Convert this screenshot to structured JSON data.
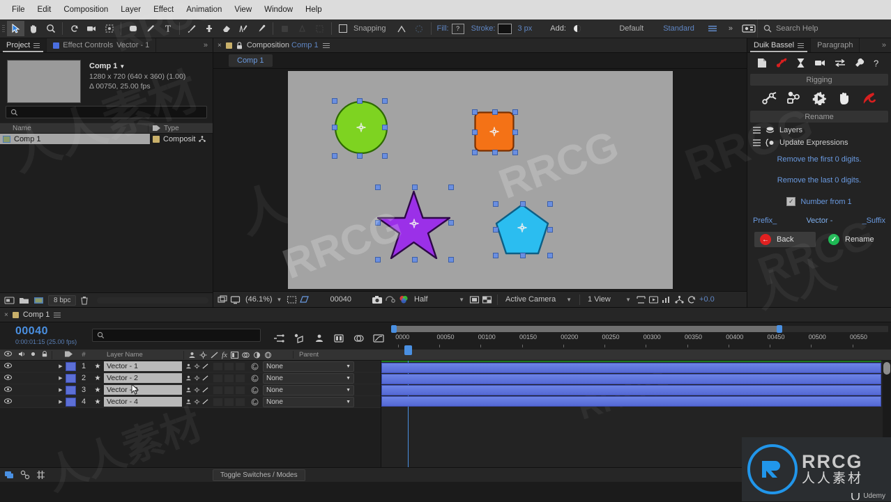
{
  "app": {
    "menus": [
      "File",
      "Edit",
      "Composition",
      "Layer",
      "Effect",
      "Animation",
      "View",
      "Window",
      "Help"
    ]
  },
  "toolbar": {
    "tools": [
      {
        "name": "selection-tool",
        "icon": "arrow",
        "active": true
      },
      {
        "name": "hand-tool",
        "icon": "hand"
      },
      {
        "name": "zoom-tool",
        "icon": "magnifier"
      },
      {
        "name": "rotation-tool",
        "icon": "rotate"
      },
      {
        "name": "camera-tool",
        "icon": "camera"
      },
      {
        "name": "pan-behind-tool",
        "icon": "anchor-point"
      },
      {
        "name": "shape-tool",
        "icon": "rounded-square"
      },
      {
        "name": "pen-tool",
        "icon": "pen"
      },
      {
        "name": "type-tool",
        "icon": "type"
      },
      {
        "name": "brush-tool",
        "icon": "brush"
      },
      {
        "name": "clone-stamp-tool",
        "icon": "stamp"
      },
      {
        "name": "eraser-tool",
        "icon": "eraser"
      },
      {
        "name": "roto-brush-tool",
        "icon": "roto-brush"
      },
      {
        "name": "puppet-pin-tool",
        "icon": "puppet-pin"
      }
    ],
    "snapping_label": "Snapping",
    "fill_label": "Fill:",
    "fill_value": "?",
    "stroke_label": "Stroke:",
    "stroke_width": "3 px",
    "add_label": "Add:",
    "workspace_default": "Default",
    "workspace_standard": "Standard",
    "overflow": "»",
    "search_help_placeholder": "Search Help"
  },
  "project_panel": {
    "tab_project": "Project",
    "tab_effect_controls": "Effect Controls",
    "tab_effect_controls_item": "Vector - 1",
    "comp_name": "Comp 1",
    "comp_resolution": "1280 x 720  (640 x 360) (1.00)",
    "comp_duration": "Δ 00750, 25.00 fps",
    "search_placeholder": "",
    "columns": [
      "Name",
      "Type"
    ],
    "rows": [
      {
        "name": "Comp 1",
        "type": "Composit",
        "selected": true
      }
    ],
    "footer": {
      "bit_depth": "8 bpc"
    }
  },
  "composition_panel": {
    "tab_label": "Composition",
    "tab_comp_name": "Comp 1",
    "sub_tab": "Comp 1",
    "footer": {
      "zoom": "(46.1%)",
      "time": "00040",
      "resolution": "Half",
      "camera": "Active Camera",
      "views": "1 View",
      "exposure": "+0.0"
    },
    "shapes": [
      {
        "name": "circle-shape-green",
        "fill": "#7ed321",
        "stroke": "#2d6a00",
        "kind": "circle"
      },
      {
        "name": "rounded-square-shape-orange",
        "fill": "#f47216",
        "stroke": "#8f3c00",
        "kind": "rounded-square"
      },
      {
        "name": "star-shape-purple",
        "fill": "#9b30e8",
        "stroke": "#3a0a5e",
        "kind": "star"
      },
      {
        "name": "pentagon-shape-cyan",
        "fill": "#2bbdf0",
        "stroke": "#0d5e85",
        "kind": "pentagon"
      }
    ]
  },
  "duik_panel": {
    "tab_duik": "Duik Bassel",
    "tab_paragraph": "Paragraph",
    "overflow": "»",
    "top_icons": [
      "new-icon",
      "rigging-icon",
      "animation-icon",
      "camera-icon",
      "links-icon",
      "tools-icon",
      "help-icon"
    ],
    "section_rigging": "Rigging",
    "rigging_icons": [
      "structure-icon",
      "links-constraints-icon",
      "automation-icon",
      "hand-icon",
      "rename-icon"
    ],
    "section_rename": "Rename",
    "rows": [
      {
        "label": "Layers",
        "icon": "layers-icon"
      },
      {
        "label": "Update Expressions",
        "icon": "expressions-icon"
      }
    ],
    "line_first": "Remove the first 0 digits.",
    "line_last": "Remove the last 0 digits.",
    "checkbox_label": "Number from 1",
    "checkbox_checked": true,
    "prefix_label": "Prefix_",
    "name_value": "Vector -",
    "suffix_label": "_Suffix",
    "back_button": "Back",
    "rename_button": "Rename",
    "back_color": "#e02020",
    "rename_color": "#1db954"
  },
  "timeline": {
    "tab_label": "Comp 1",
    "current_time": "00040",
    "current_time_sub": "0:00:01:15 (25.00 fps)",
    "search_placeholder": "",
    "columns": {
      "layer_name": "Layer Name",
      "parent": "Parent",
      "num": "#"
    },
    "ruler_ticks": [
      "0000",
      "00050",
      "00100",
      "00150",
      "00200",
      "00250",
      "00300",
      "00350",
      "00400",
      "00450",
      "00500",
      "00550"
    ],
    "layers": [
      {
        "index": "1",
        "name": "Vector - 1",
        "parent": "None"
      },
      {
        "index": "2",
        "name": "Vector - 2",
        "parent": "None"
      },
      {
        "index": "3",
        "name": "Vector - 3",
        "parent": "None"
      },
      {
        "index": "4",
        "name": "Vector - 4",
        "parent": "None"
      }
    ],
    "toggle_switches": "Toggle Switches / Modes"
  },
  "branding": {
    "logo_text": "RRCG",
    "logo_sub": "人人素材",
    "udemy": "Udemy",
    "watermarks": [
      "RRCG",
      "人人素材"
    ]
  }
}
